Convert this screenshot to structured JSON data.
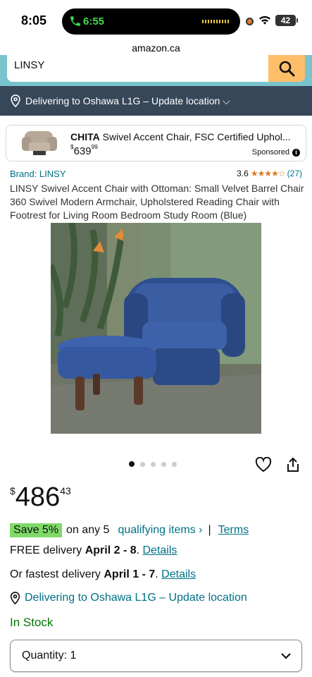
{
  "status_bar": {
    "time": "8:05",
    "call_time": "6:55",
    "battery": "42"
  },
  "browser": {
    "url": "amazon.ca"
  },
  "search": {
    "value": "LINSY"
  },
  "delivery_bar": {
    "text": "Delivering to Oshawa L1G – Update location ⌵"
  },
  "ad": {
    "brand": "CHITA",
    "title_rest": " Swivel Accent Chair, FSC Certified Uphol...",
    "price_currency": "$",
    "price_whole": "639",
    "price_cents": "99",
    "sponsored": "Sponsored"
  },
  "product": {
    "brand": "Brand: LINSY",
    "rating": "3.6",
    "stars": "★★★★☆",
    "rating_fraction": 0.72,
    "review_count": "(27)",
    "title": "LINSY Swivel Accent Chair with Ottoman: Small Velvet Barrel Chair 360 Swivel Modern Armchair, Upholstered Reading Chair with Footrest for Living Room Bedroom Study Room (Blue)",
    "image_count": 5,
    "image_index": 1,
    "price_currency": "$",
    "price_whole": "486",
    "price_cents": "43"
  },
  "offers": {
    "save_badge": "Save 5%",
    "save_text": "on any 5",
    "qualifying": "qualifying items ›",
    "separator": "|",
    "terms": "Terms"
  },
  "delivery": {
    "free_prefix": "FREE delivery ",
    "free_dates": "April 2 - 8",
    "free_suffix": ". ",
    "free_link": "Details",
    "fast_prefix": "Or fastest delivery ",
    "fast_dates": "April 1 - 7",
    "fast_suffix": ". ",
    "fast_link": "Details",
    "location": "Delivering to Oshawa L1G – Update location"
  },
  "stock": "In Stock",
  "quantity": {
    "label": "Quantity: 1"
  },
  "colors": {
    "accent_link": "#007185",
    "search_button": "#febd69",
    "header": "#37475a",
    "save_badge": "#7fda69",
    "in_stock": "#007600"
  }
}
